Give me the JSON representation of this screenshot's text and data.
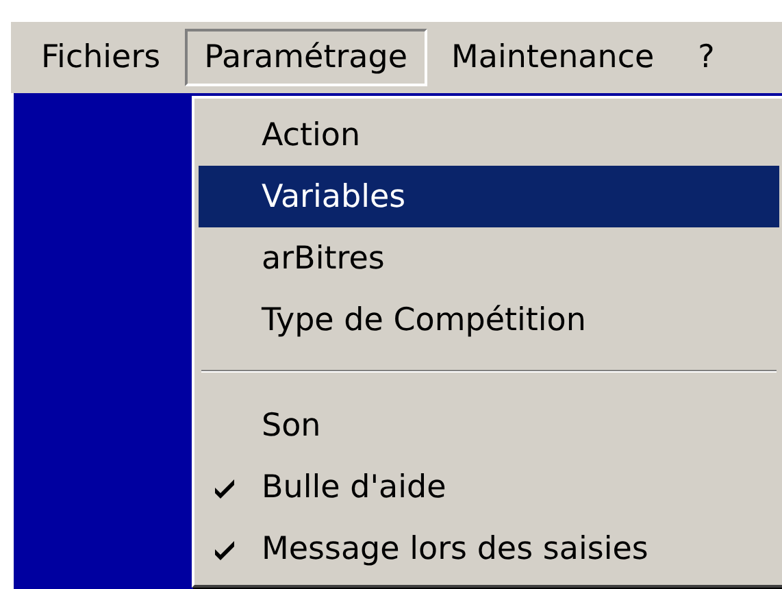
{
  "menu_bar": [
    {
      "label": "Fichiers",
      "selected": false
    },
    {
      "label": "Paramétrage",
      "selected": true
    },
    {
      "label": "Maintenance",
      "selected": false
    },
    {
      "label": "?",
      "selected": false
    }
  ],
  "dropdown": [
    {
      "kind": "item",
      "label": "Action",
      "selected": false,
      "checked": false
    },
    {
      "kind": "item",
      "label": "Variables",
      "selected": true,
      "checked": false
    },
    {
      "kind": "item",
      "label": "arBitres",
      "selected": false,
      "checked": false
    },
    {
      "kind": "item",
      "label": "Type de Compétition",
      "selected": false,
      "checked": false
    },
    {
      "kind": "separator"
    },
    {
      "kind": "item",
      "label": "Son",
      "selected": false,
      "checked": false
    },
    {
      "kind": "item",
      "label": "Bulle d'aide",
      "selected": false,
      "checked": true
    },
    {
      "kind": "item",
      "label": "Message lors des saisies",
      "selected": false,
      "checked": true
    }
  ]
}
